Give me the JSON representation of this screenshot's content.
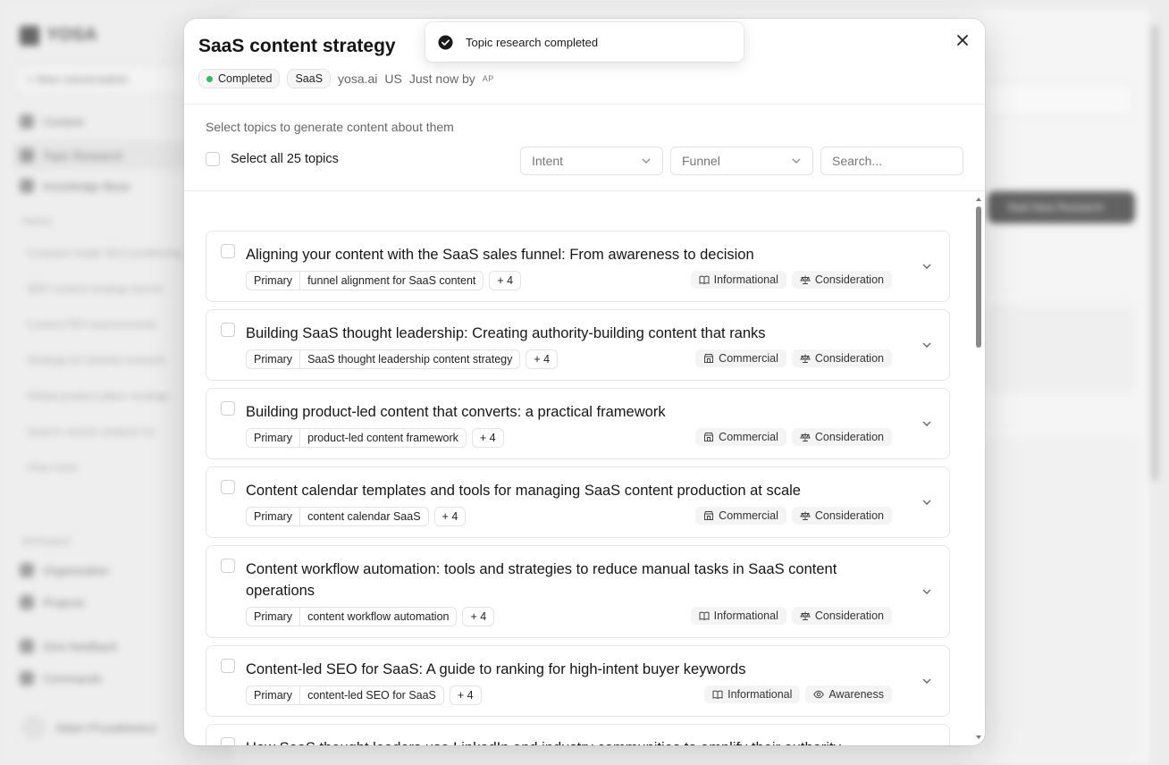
{
  "modal": {
    "title": "SaaS content strategy",
    "status": "Completed",
    "tag": "SaaS",
    "domain": "yosa.ai",
    "country": "US",
    "created": "Just now by",
    "author_initials": "AP"
  },
  "toast": {
    "message": "Topic research completed"
  },
  "filters": {
    "hint": "Select topics to generate content about them",
    "select_all": "Select all 25 topics",
    "intent_label": "Intent",
    "funnel_label": "Funnel",
    "search_placeholder": "Search..."
  },
  "topics": [
    {
      "title": "Aligning your content with the SaaS sales funnel: From awareness to decision",
      "type": "Primary",
      "keyword": "funnel alignment for SaaS content",
      "more": "+ 4",
      "intent": "Informational",
      "intent_icon": "book-icon",
      "stage": "Consideration",
      "stage_icon": "scale-icon"
    },
    {
      "title": "Building SaaS thought leadership: Creating authority-building content that ranks",
      "type": "Primary",
      "keyword": "SaaS thought leadership content strategy",
      "more": "+ 4",
      "intent": "Commercial",
      "intent_icon": "store-icon",
      "stage": "Consideration",
      "stage_icon": "scale-icon"
    },
    {
      "title": "Building product-led content that converts: a practical framework",
      "type": "Primary",
      "keyword": "product-led content framework",
      "more": "+ 4",
      "intent": "Commercial",
      "intent_icon": "store-icon",
      "stage": "Consideration",
      "stage_icon": "scale-icon"
    },
    {
      "title": "Content calendar templates and tools for managing SaaS content production at scale",
      "type": "Primary",
      "keyword": "content calendar SaaS",
      "more": "+ 4",
      "intent": "Commercial",
      "intent_icon": "store-icon",
      "stage": "Consideration",
      "stage_icon": "scale-icon"
    },
    {
      "title": "Content workflow automation: tools and strategies to reduce manual tasks in SaaS content operations",
      "type": "Primary",
      "keyword": "content workflow automation",
      "more": "+ 4",
      "intent": "Informational",
      "intent_icon": "book-icon",
      "stage": "Consideration",
      "stage_icon": "scale-icon"
    },
    {
      "title": "Content-led SEO for SaaS: A guide to ranking for high-intent buyer keywords",
      "type": "Primary",
      "keyword": "content-led SEO for SaaS",
      "more": "+ 4",
      "intent": "Informational",
      "intent_icon": "book-icon",
      "stage": "Awareness",
      "stage_icon": "eye-icon"
    },
    {
      "title": "How SaaS thought leaders use LinkedIn and industry communities to amplify their authority",
      "type": "",
      "keyword": "",
      "more": "",
      "intent": "",
      "intent_icon": "",
      "stage": "",
      "stage_icon": ""
    }
  ],
  "colors": {
    "status_dot": "#22c55e",
    "accent_dark": "#1a1a1a"
  }
}
